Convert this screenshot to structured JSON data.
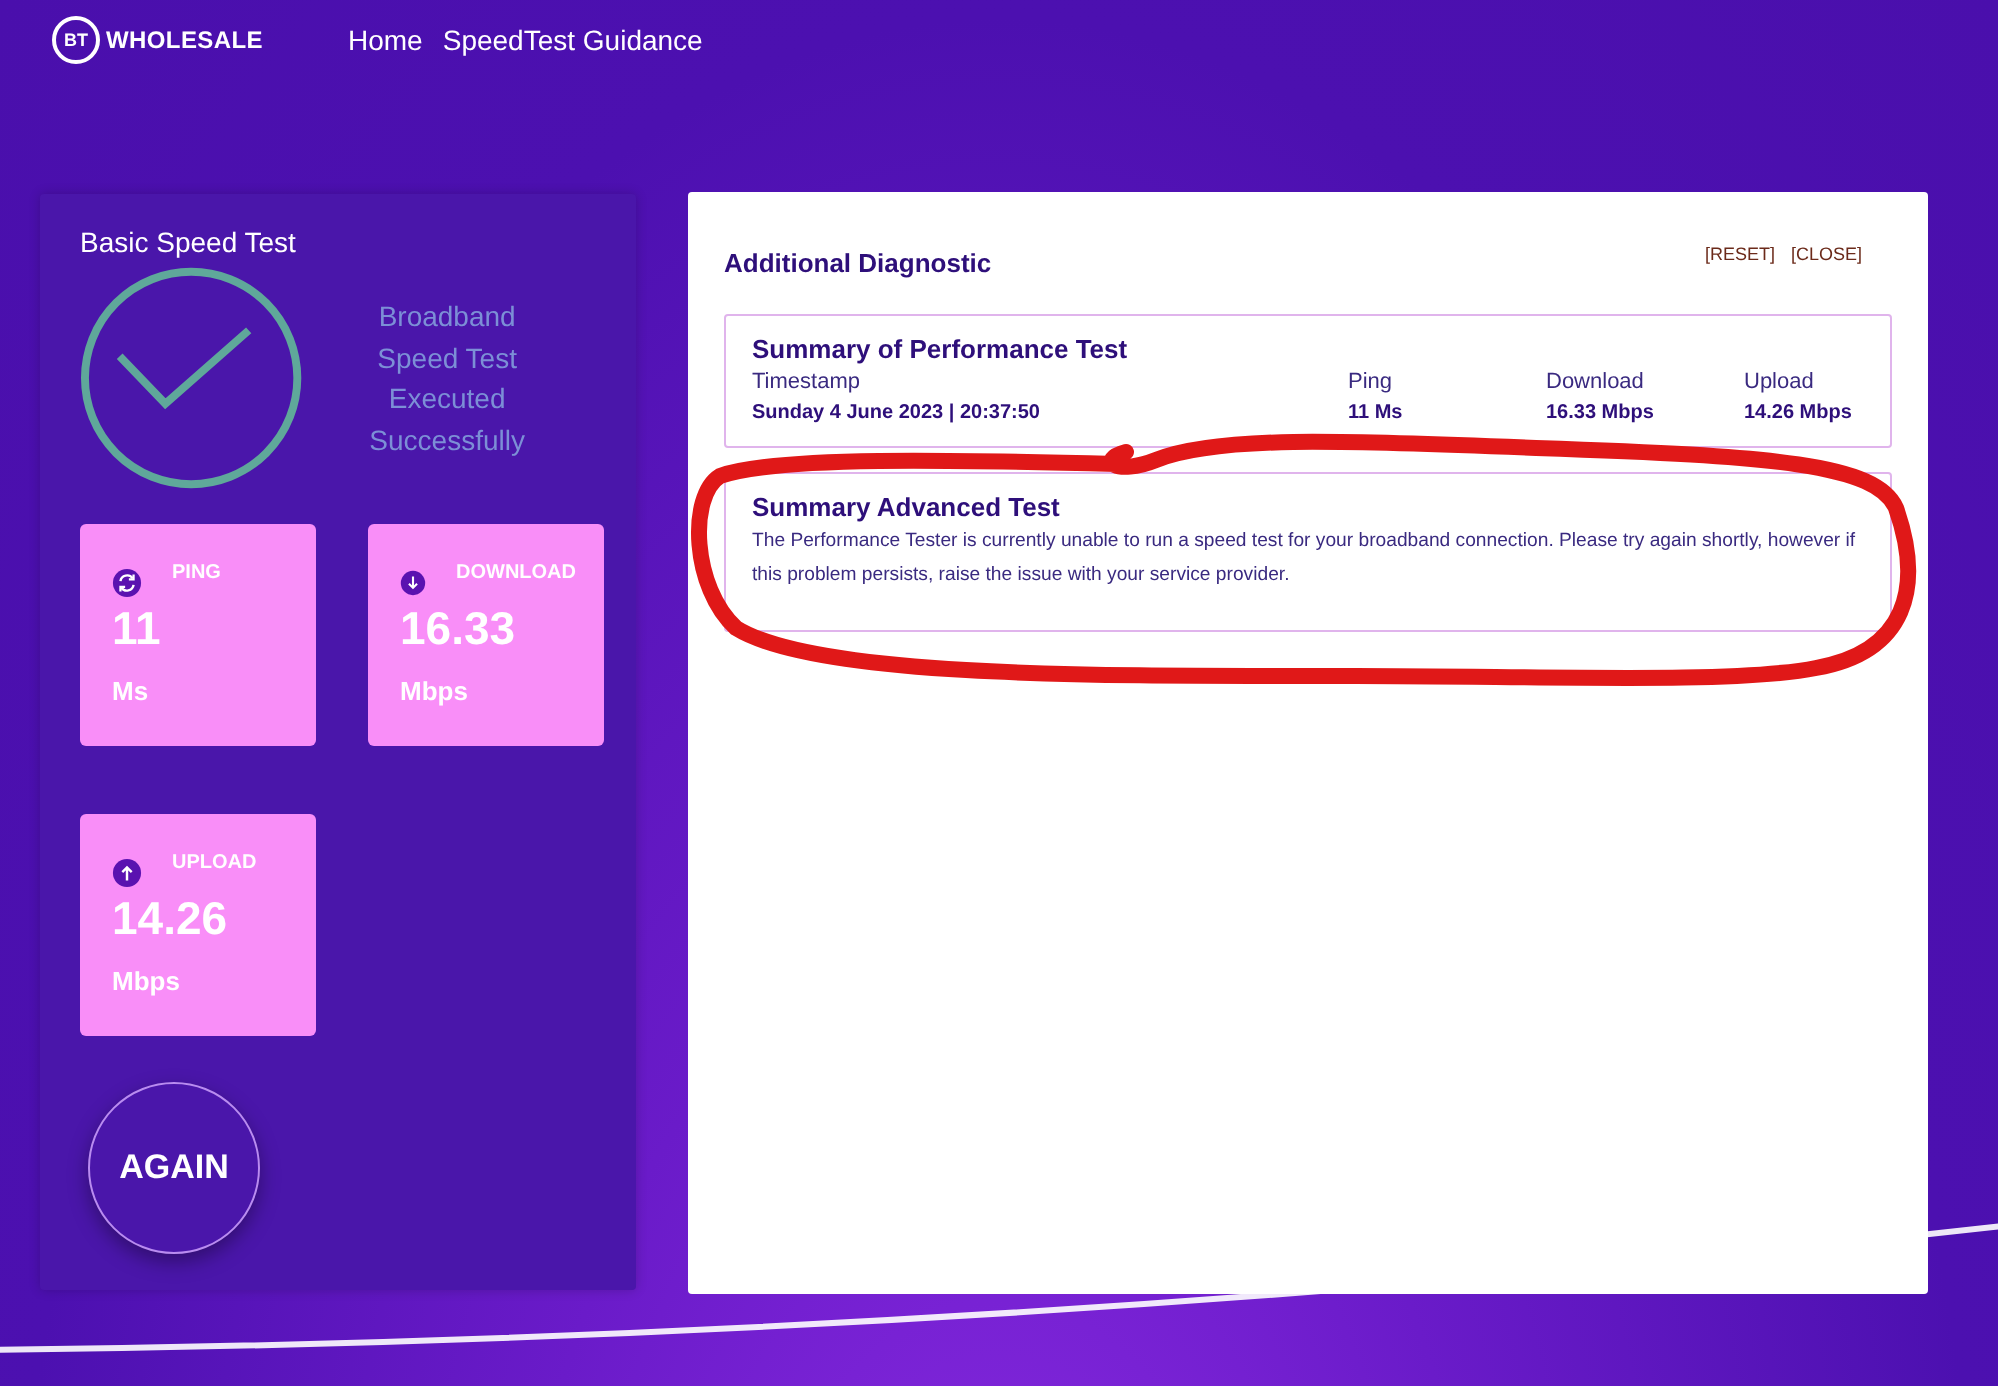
{
  "header": {
    "logo": {
      "badge": "BT",
      "text": "WHOLESALE"
    },
    "nav": [
      {
        "label": "Home"
      },
      {
        "label": "SpeedTest Guidance"
      }
    ]
  },
  "basic_test": {
    "title": "Basic Speed Test",
    "status_lines": [
      "Broadband",
      "Speed Test",
      "Executed",
      "Successfully"
    ],
    "metrics": [
      {
        "kind": "ping",
        "label": "PING",
        "value": "11",
        "unit": "Ms"
      },
      {
        "kind": "download",
        "label": "DOWNLOAD",
        "value": "16.33",
        "unit": "Mbps"
      },
      {
        "kind": "upload",
        "label": "UPLOAD",
        "value": "14.26",
        "unit": "Mbps"
      }
    ],
    "again_button": "AGAIN"
  },
  "diagnostic": {
    "title": "Additional Diagnostic",
    "actions": [
      "[RESET]",
      "[CLOSE]"
    ],
    "performance": {
      "title": "Summary of Performance Test",
      "columns": [
        "Timestamp",
        "Ping",
        "Download",
        "Upload"
      ],
      "values": [
        "Sunday 4 June 2023 | 20:37:50",
        "11 Ms",
        "16.33 Mbps",
        "14.26 Mbps"
      ]
    },
    "advanced": {
      "title": "Summary Advanced Test",
      "message": "The Performance Tester is currently unable to run a speed test for your broadband connection. Please try again shortly, however if this problem persists, raise the issue with your service provider.",
      "annotated": true
    }
  }
}
